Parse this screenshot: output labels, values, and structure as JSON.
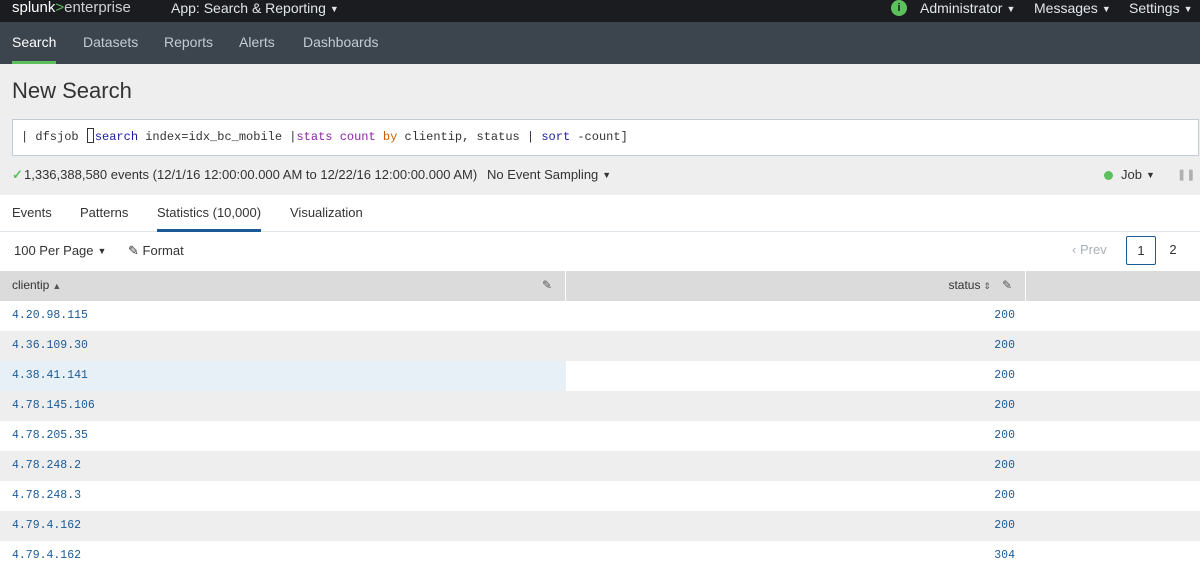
{
  "topbar": {
    "logo_part1": "splunk",
    "logo_part2": ">",
    "logo_part3": "enterprise",
    "app_menu": "App: Search & Reporting",
    "info_icon": "i",
    "administrator": "Administrator",
    "messages": "Messages",
    "settings": "Settings"
  },
  "nav": {
    "items": [
      "Search",
      "Datasets",
      "Reports",
      "Alerts",
      "Dashboards"
    ],
    "active": "Search"
  },
  "page": {
    "title": "New Search"
  },
  "search": {
    "q1": "| dfsjob ",
    "q2": "search",
    "q3": " index=idx_bc_mobile |",
    "q4": "stats",
    "q5": " ",
    "q6": "count",
    "q7": " ",
    "q8": "by",
    "q9": " clientip, status | ",
    "q10": "sort",
    "q11": " -count]"
  },
  "status": {
    "events": "1,336,388,580 events (12/1/16 12:00:00.000 AM to 12/22/16 12:00:00.000 AM)",
    "sampling": "No Event Sampling",
    "job": "Job"
  },
  "tabs": [
    "Events",
    "Patterns",
    "Statistics (10,000)",
    "Visualization"
  ],
  "active_tab": "Statistics (10,000)",
  "controls": {
    "per_page": "100 Per Page",
    "format": "Format",
    "prev": "Prev",
    "page_current": "1",
    "page_next": "2"
  },
  "table": {
    "columns": [
      "clientip",
      "status"
    ],
    "rows": [
      {
        "clientip": "4.20.98.115",
        "status": "200"
      },
      {
        "clientip": "4.36.109.30",
        "status": "200"
      },
      {
        "clientip": "4.38.41.141",
        "status": "200"
      },
      {
        "clientip": "4.78.145.106",
        "status": "200"
      },
      {
        "clientip": "4.78.205.35",
        "status": "200"
      },
      {
        "clientip": "4.78.248.2",
        "status": "200"
      },
      {
        "clientip": "4.78.248.3",
        "status": "200"
      },
      {
        "clientip": "4.79.4.162",
        "status": "200"
      },
      {
        "clientip": "4.79.4.162",
        "status": "304"
      }
    ]
  },
  "colors": {
    "brand_green": "#5cc05c",
    "link_blue": "#1a5a96",
    "topbar_bg": "#1a1c20",
    "navbar_bg": "#3c444d"
  }
}
